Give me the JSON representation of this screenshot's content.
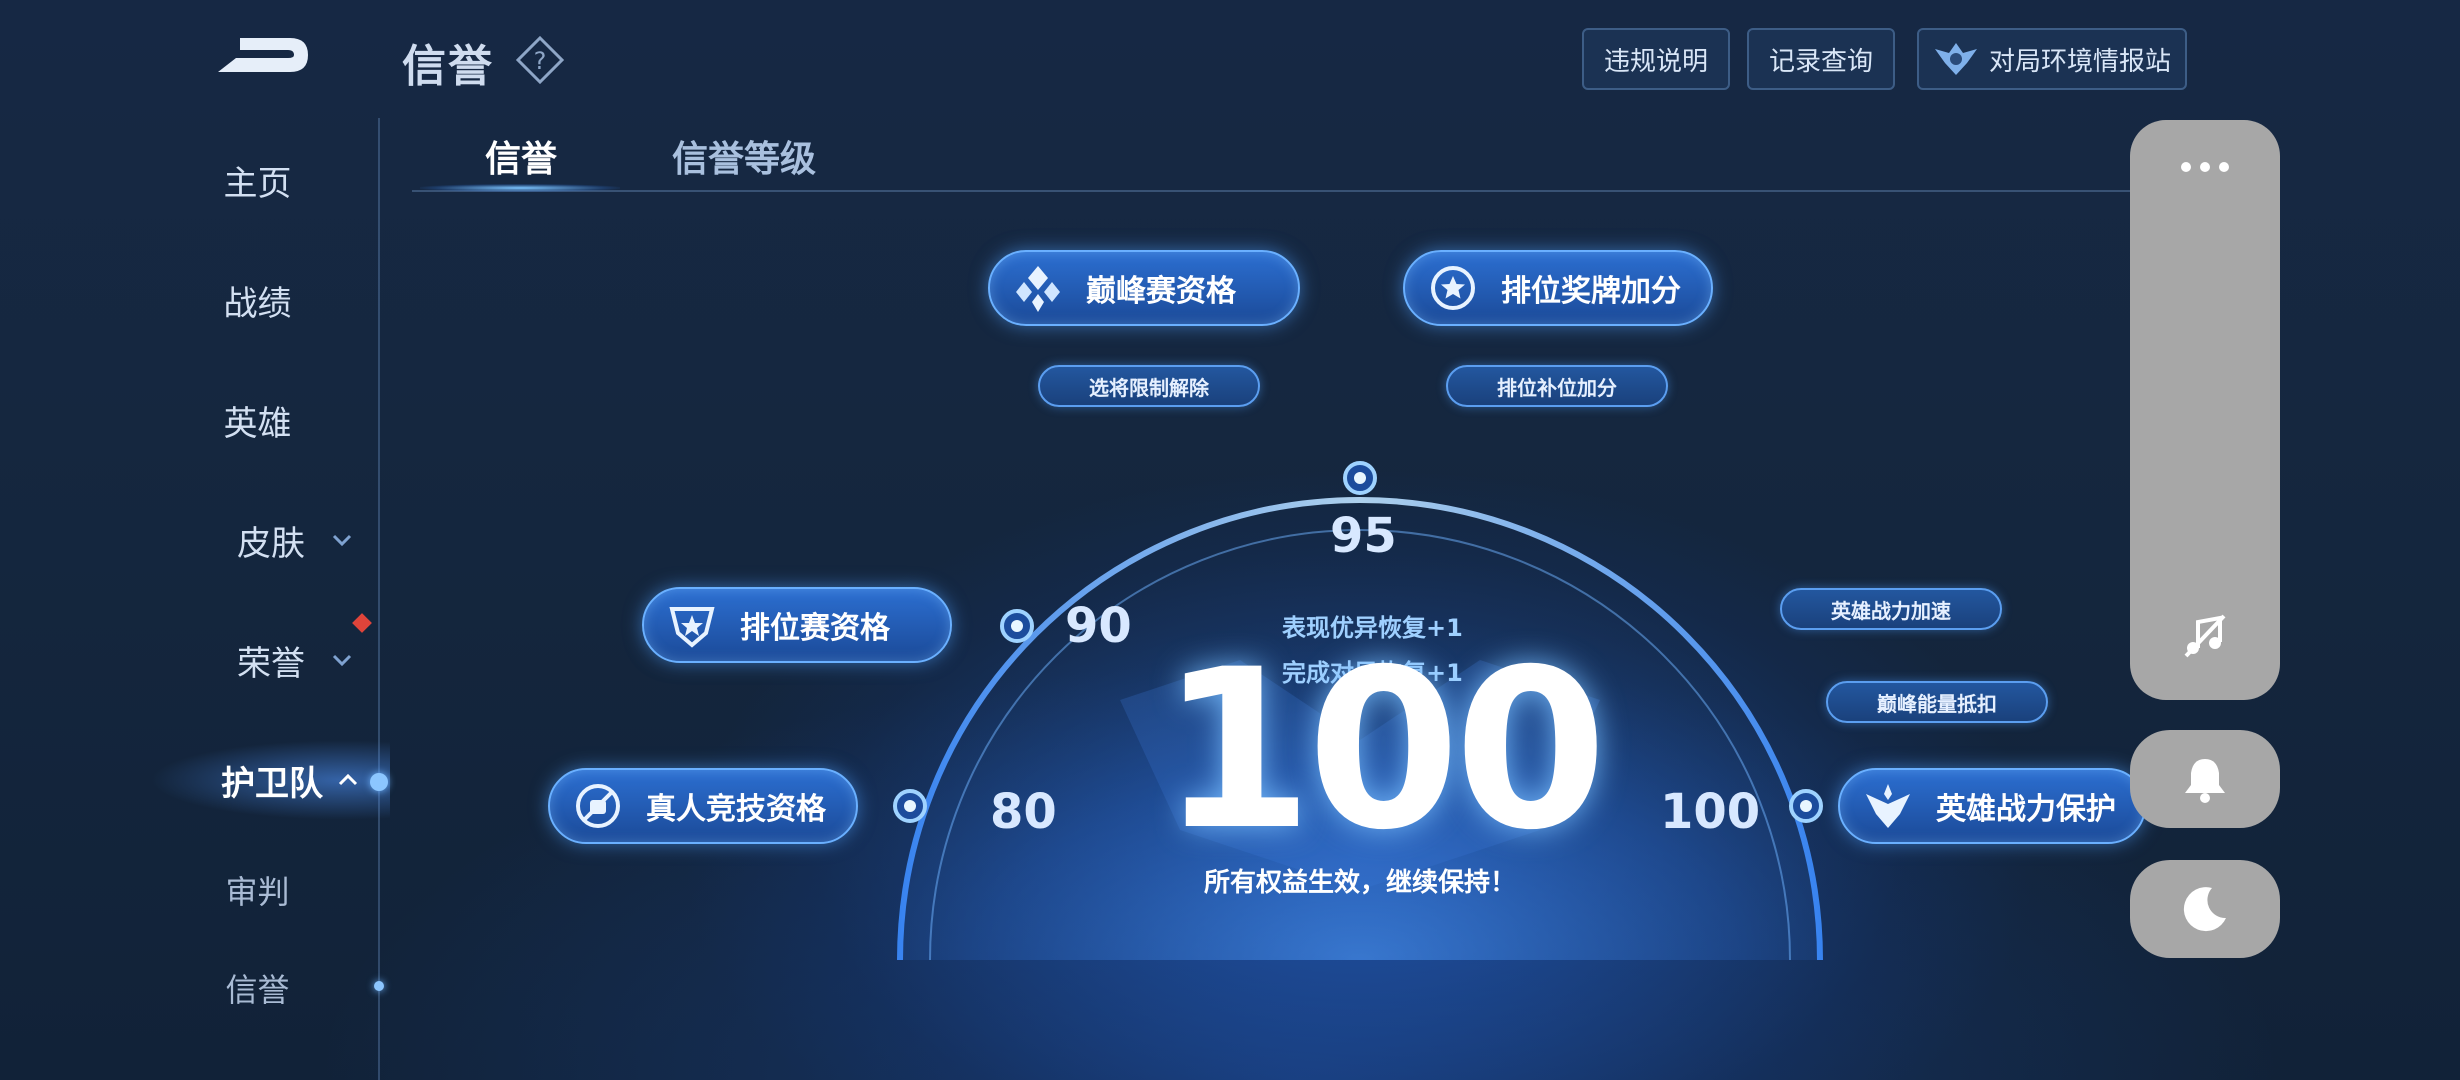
{
  "header": {
    "title": "信誉",
    "buttons": [
      "违规说明",
      "记录查询",
      "对局环境情报站"
    ]
  },
  "sidebar": {
    "items": [
      "主页",
      "战绩",
      "英雄",
      "皮肤",
      "荣誉",
      "护卫队",
      "审判",
      "信誉"
    ],
    "active": "护卫队"
  },
  "tabs": [
    "信誉",
    "信誉等级"
  ],
  "perks": {
    "peak": "巅峰赛资格",
    "rank_medal": "排位奖牌加分",
    "hero_pick_unlock": "选将限制解除",
    "rank_fill_bonus": "排位补位加分",
    "ranked": "排位赛资格",
    "real_person": "真人竞技资格",
    "hero_power_speed": "英雄战力加速",
    "peak_energy": "巅峰能量抵扣",
    "hero_power_protect": "英雄战力保护"
  },
  "gauge": {
    "thresholds": [
      "80",
      "90",
      "95",
      "100"
    ],
    "recover_good": "表现优异恢复+1",
    "recover_match": "完成对局恢复+1",
    "score": "100",
    "caption": "所有权益生效，继续保持！"
  },
  "colors": {
    "accent": "#6ab0ff",
    "pill": "#2c6fd1",
    "background": "#15273f",
    "badge_red": "#e0443a",
    "float_panel": "#a7a7a7"
  }
}
